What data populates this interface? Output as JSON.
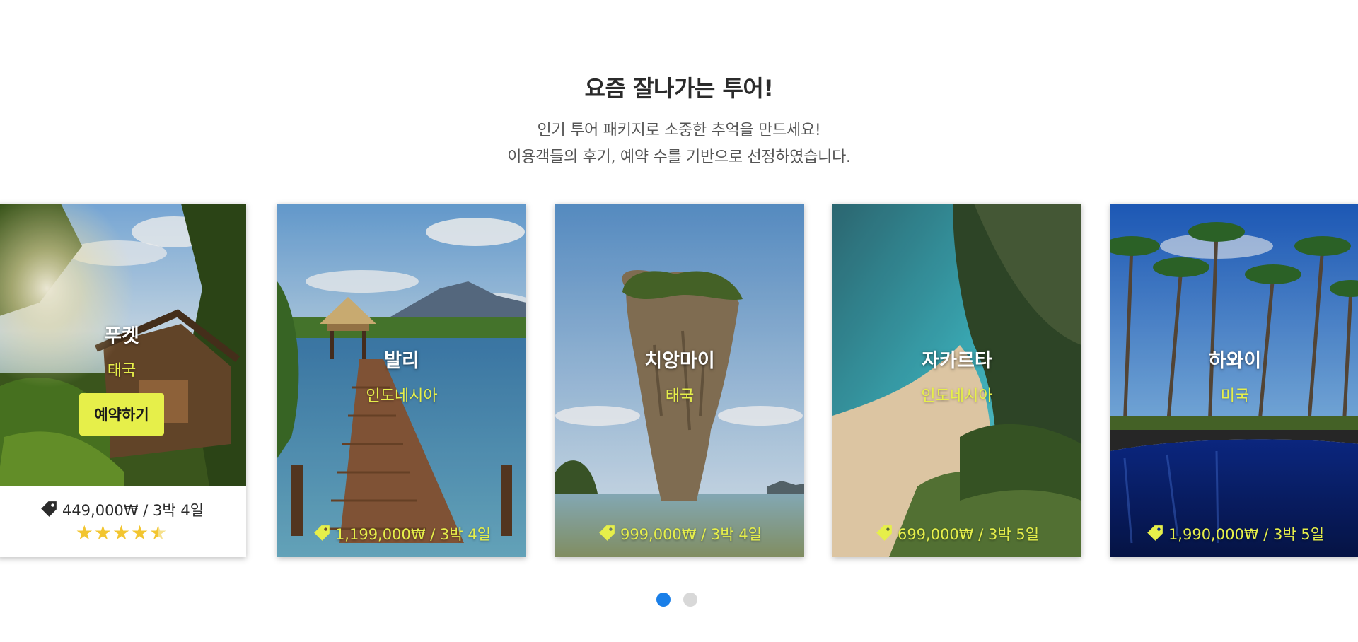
{
  "header": {
    "title": "요즘 잘나가는 투어!",
    "subtitle_line1": "인기 투어 패키지로 소중한 추억을 만드세요!",
    "subtitle_line2": "이용객들의 후기, 예약 수를 기반으로 선정하였습니다."
  },
  "colors": {
    "accent_yellow": "#e6ef4a",
    "dot_active": "#1a7fe8",
    "dot_inactive": "#d8d8d8",
    "star": "#f2c530"
  },
  "cards": [
    {
      "destination": "푸켓",
      "country": "태국",
      "book_label": "예약하기",
      "price": "449,000₩ / 3박 4일",
      "rating": 4.5,
      "stars": "★★★★"
    },
    {
      "destination": "발리",
      "country": "인도네시아",
      "price": "1,199,000₩ / 3박 4일"
    },
    {
      "destination": "치앙마이",
      "country": "태국",
      "price": "999,000₩ / 3박 4일"
    },
    {
      "destination": "자카르타",
      "country": "인도네시아",
      "price": "699,000₩ / 3박 5일"
    },
    {
      "destination": "하와이",
      "country": "미국",
      "price": "1,990,000₩ / 3박 5일"
    }
  ],
  "pagination": {
    "pages": 2,
    "current": 1
  }
}
